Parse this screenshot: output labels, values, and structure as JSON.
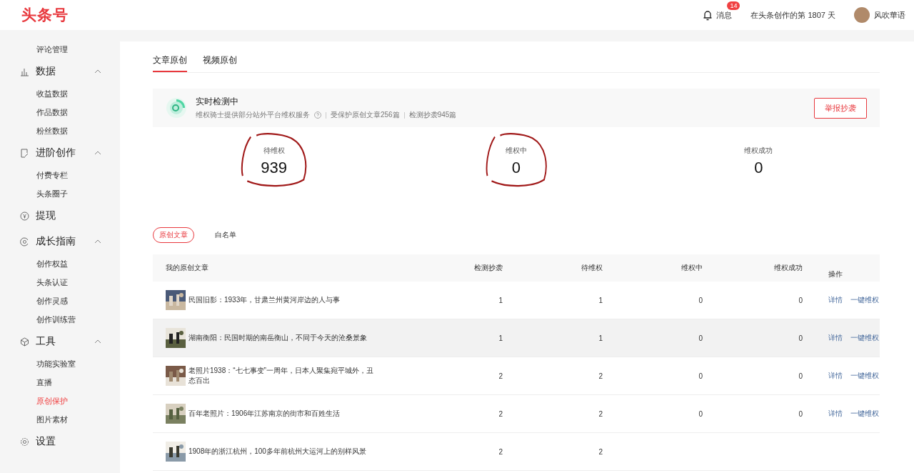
{
  "header": {
    "logo": "头条号",
    "messages": {
      "label": "消息",
      "badge": "14"
    },
    "days": "在头条创作的第 1807 天",
    "user": "风吹華语"
  },
  "sidebar": {
    "groups": [
      {
        "items": [
          {
            "label": "评论管理",
            "selected": false
          }
        ]
      },
      {
        "title": "数据",
        "expanded": true,
        "items": [
          {
            "label": "收益数据",
            "selected": false
          },
          {
            "label": "作品数据",
            "selected": false
          },
          {
            "label": "粉丝数据",
            "selected": false
          }
        ]
      },
      {
        "title": "进阶创作",
        "expanded": true,
        "items": [
          {
            "label": "付费专栏",
            "selected": false
          },
          {
            "label": "头条圈子",
            "selected": false
          }
        ]
      },
      {
        "title": "提现"
      },
      {
        "title": "成长指南",
        "expanded": true,
        "items": [
          {
            "label": "创作权益",
            "selected": false
          },
          {
            "label": "头条认证",
            "selected": false
          },
          {
            "label": "创作灵感",
            "selected": false
          },
          {
            "label": "创作训练营",
            "selected": false
          }
        ]
      },
      {
        "title": "工具",
        "expanded": true,
        "items": [
          {
            "label": "功能实验室",
            "selected": false
          },
          {
            "label": "直播",
            "selected": false
          },
          {
            "label": "原创保护",
            "selected": true
          },
          {
            "label": "图片素材",
            "selected": false
          }
        ]
      },
      {
        "title": "设置"
      }
    ]
  },
  "tabs": [
    {
      "label": "文章原创",
      "selected": true
    },
    {
      "label": "视频原创",
      "selected": false
    }
  ],
  "monitor": {
    "title": "实时检测中",
    "service": "维权骑士提供部分站外平台维权服务",
    "protected": "受保护原创文章256篇",
    "detected": "检测抄袭945篇",
    "button": "举报抄袭"
  },
  "stats": [
    {
      "label": "待维权",
      "value": "939",
      "circled": true
    },
    {
      "label": "维权中",
      "value": "0",
      "circled": true
    },
    {
      "label": "维权成功",
      "value": "0",
      "circled": false
    }
  ],
  "subtabs": [
    {
      "label": "原创文章",
      "selected": true
    },
    {
      "label": "白名单",
      "selected": false
    }
  ],
  "table": {
    "columns": [
      "我的原创文章",
      "检测抄袭",
      "待维权",
      "维权中",
      "维权成功",
      "操作"
    ],
    "rows": [
      {
        "title": "民国旧影：1933年，甘肃兰州黄河岸边的人与事",
        "counts": [
          "1",
          "1",
          "0",
          "0"
        ],
        "actions": [
          "详情",
          "一键维权"
        ],
        "hovered": false
      },
      {
        "title": "湖南衡阳：民国时期的南岳衡山，不同于今天的沧桑景象",
        "counts": [
          "1",
          "1",
          "0",
          "0"
        ],
        "actions": [
          "详情",
          "一键维权"
        ],
        "hovered": true
      },
      {
        "title": "老照片1938：“七七事变”一周年，日本人聚集宛平城外，丑态百出",
        "counts": [
          "2",
          "2",
          "0",
          "0"
        ],
        "actions": [
          "详情",
          "一键维权"
        ],
        "hovered": false
      },
      {
        "title": "百年老照片：1906年江苏南京的街市和百姓生活",
        "counts": [
          "2",
          "2",
          "0",
          "0"
        ],
        "actions": [
          "详情",
          "一键维权"
        ],
        "hovered": false
      },
      {
        "title": "1908年的浙江杭州，100多年前杭州大运河上的别样风景",
        "counts": [
          "2",
          "2"
        ],
        "actions": [],
        "hovered": false
      }
    ]
  }
}
